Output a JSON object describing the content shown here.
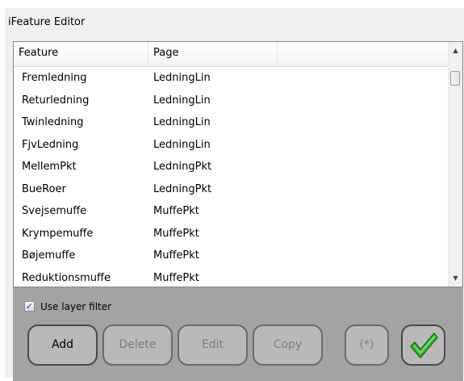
{
  "window": {
    "title": "iFeature Editor"
  },
  "list": {
    "columns": [
      "Feature",
      "Page"
    ],
    "rows": [
      {
        "feature": "Fremledning",
        "page": "LedningLin"
      },
      {
        "feature": "Returledning",
        "page": "LedningLin"
      },
      {
        "feature": "Twinledning",
        "page": "LedningLin"
      },
      {
        "feature": "FjvLedning",
        "page": "LedningLin"
      },
      {
        "feature": "MellemPkt",
        "page": "LedningPkt"
      },
      {
        "feature": "BueRoer",
        "page": "LedningPkt"
      },
      {
        "feature": "Svejsemuffe",
        "page": "MuffePkt"
      },
      {
        "feature": "Krympemuffe",
        "page": "MuffePkt"
      },
      {
        "feature": "Bøjemuffe",
        "page": "MuffePkt"
      },
      {
        "feature": "Reduktionsmuffe",
        "page": "MuffePkt"
      }
    ]
  },
  "filter": {
    "label": "Use layer filter",
    "checked": true
  },
  "buttons": {
    "add": "Add",
    "delete": "Delete",
    "edit": "Edit",
    "copy": "Copy",
    "star": "(*)"
  },
  "icons": {
    "scroll_up": "up-arrow-icon",
    "scroll_down": "down-arrow-icon",
    "confirm": "green-checkmark-icon",
    "check": "checkmark-icon"
  },
  "colors": {
    "panel_bg": "#a3a3a3",
    "button_bg": "#b9b9b9",
    "check_green": "#3fb83a"
  }
}
